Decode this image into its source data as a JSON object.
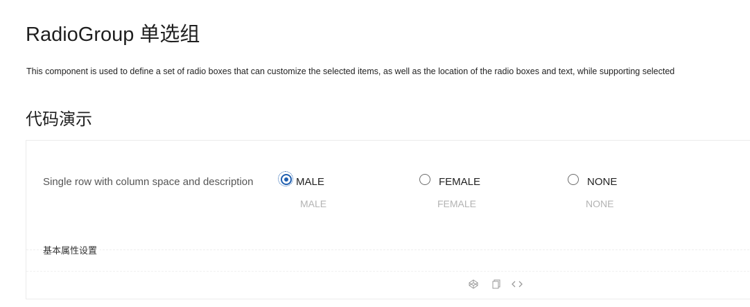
{
  "header": {
    "title": "RadioGroup 单选组",
    "description": "This component is used to define a set of radio boxes that can customize the selected items, as well as the location of the radio boxes and text, while supporting selected"
  },
  "section": {
    "title": "代码演示"
  },
  "demo": {
    "row_label": "Single row with column space and description",
    "options": [
      {
        "label": "MALE",
        "description": "MALE",
        "checked": true
      },
      {
        "label": "FEMALE",
        "description": "FEMALE",
        "checked": false
      },
      {
        "label": "NONE",
        "description": "NONE",
        "checked": false
      }
    ],
    "divider_label": "基本属性设置",
    "toolbar_icons": [
      "codepen-icon",
      "copy-icon",
      "code-icon"
    ]
  },
  "colors": {
    "accent": "#1f5fb0",
    "muted_text": "#b3b3b3"
  }
}
